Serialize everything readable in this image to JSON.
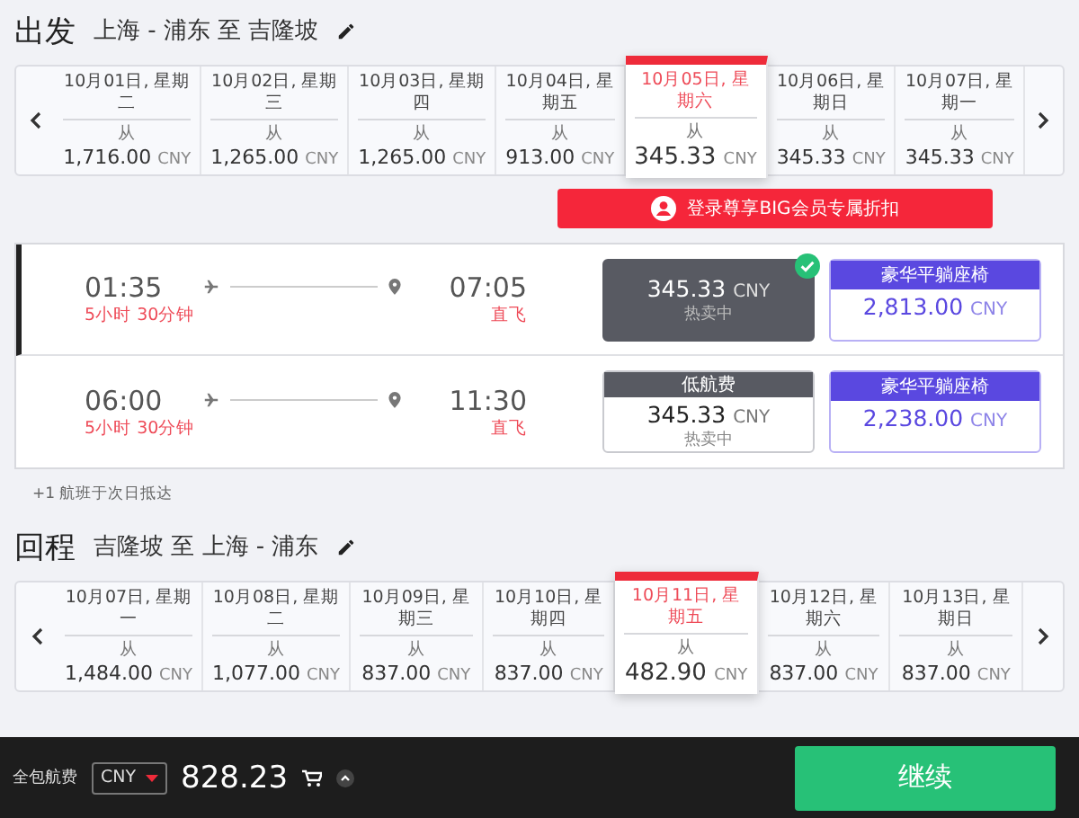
{
  "outbound": {
    "label": "出发",
    "route": "上海 - 浦东 至 吉隆坡",
    "dates": [
      {
        "date": "10月01日, 星期二",
        "from": "从",
        "price": "1,716.00",
        "currency": "CNY",
        "selected": false
      },
      {
        "date": "10月02日, 星期三",
        "from": "从",
        "price": "1,265.00",
        "currency": "CNY",
        "selected": false
      },
      {
        "date": "10月03日, 星期四",
        "from": "从",
        "price": "1,265.00",
        "currency": "CNY",
        "selected": false
      },
      {
        "date": "10月04日, 星期五",
        "from": "从",
        "price": "913.00",
        "currency": "CNY",
        "selected": false
      },
      {
        "date": "10月05日, 星期六",
        "from": "从",
        "price": "345.33",
        "currency": "CNY",
        "selected": true
      },
      {
        "date": "10月06日, 星期日",
        "from": "从",
        "price": "345.33",
        "currency": "CNY",
        "selected": false
      },
      {
        "date": "10月07日, 星期一",
        "from": "从",
        "price": "345.33",
        "currency": "CNY",
        "selected": false
      }
    ]
  },
  "login_button": "登录尊享BIG会员专属折扣",
  "flights": [
    {
      "depart": "01:35",
      "duration": "5小时 30分钟",
      "arrive": "07:05",
      "stops": "直飞",
      "selected": true,
      "fares": [
        {
          "kind": "economy",
          "price": "345.33",
          "currency": "CNY",
          "note": "热卖中",
          "selected": true
        },
        {
          "kind": "premium",
          "header": "豪华平躺座椅",
          "price": "2,813.00",
          "currency": "CNY",
          "selected": false
        }
      ]
    },
    {
      "depart": "06:00",
      "duration": "5小时 30分钟",
      "arrive": "11:30",
      "stops": "直飞",
      "selected": false,
      "fares": [
        {
          "kind": "economy",
          "header": "低航费",
          "price": "345.33",
          "currency": "CNY",
          "note": "热卖中",
          "selected": false
        },
        {
          "kind": "premium",
          "header": "豪华平躺座椅",
          "price": "2,238.00",
          "currency": "CNY",
          "selected": false
        }
      ]
    }
  ],
  "next_day_note": "+1 航班于次日抵达",
  "return": {
    "label": "回程",
    "route": "吉隆坡 至 上海 - 浦东",
    "dates": [
      {
        "date": "10月07日, 星期一",
        "from": "从",
        "price": "1,484.00",
        "currency": "CNY",
        "selected": false
      },
      {
        "date": "10月08日, 星期二",
        "from": "从",
        "price": "1,077.00",
        "currency": "CNY",
        "selected": false
      },
      {
        "date": "10月09日, 星期三",
        "from": "从",
        "price": "837.00",
        "currency": "CNY",
        "selected": false
      },
      {
        "date": "10月10日, 星期四",
        "from": "从",
        "price": "837.00",
        "currency": "CNY",
        "selected": false
      },
      {
        "date": "10月11日, 星期五",
        "from": "从",
        "price": "482.90",
        "currency": "CNY",
        "selected": true
      },
      {
        "date": "10月12日, 星期六",
        "from": "从",
        "price": "837.00",
        "currency": "CNY",
        "selected": false
      },
      {
        "date": "10月13日, 星期日",
        "from": "从",
        "price": "837.00",
        "currency": "CNY",
        "selected": false
      }
    ]
  },
  "footer": {
    "label": "全包航费",
    "currency": "CNY",
    "total": "828.23",
    "continue_button": "继续"
  }
}
